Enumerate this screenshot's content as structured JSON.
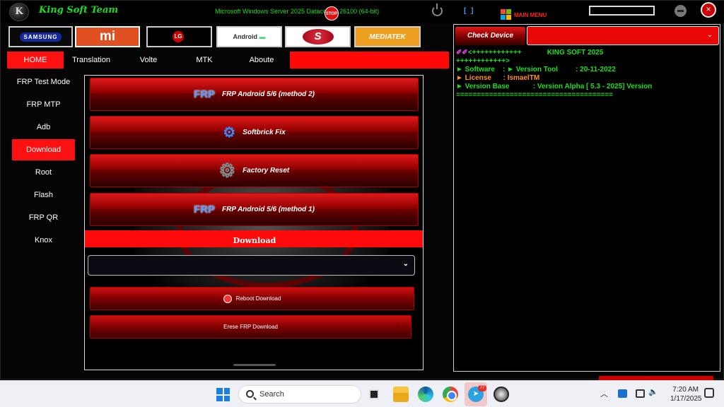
{
  "titlebar": {
    "logo_text": "K",
    "app_title": "King Soft Team",
    "os_info": "Microsoft Windows Server 2025 Datacenter 26100 (64-bit)",
    "stop_label": "STOP",
    "brackets": "[ ]",
    "main_menu": "MAIN MENU",
    "close_label": "×"
  },
  "brands": {
    "samsung": "SAMSUNG",
    "mi": "mi",
    "lg": "LG",
    "android": "Android",
    "snapdragon": "S",
    "mediatek": "MEDIATEK"
  },
  "nav": {
    "home": "HOME",
    "translation": "Translation",
    "volte": "Volte",
    "mtk": "MTK",
    "aboute": "Aboute"
  },
  "sidebar": {
    "items": [
      {
        "label": "FRP Test Mode"
      },
      {
        "label": "FRP MTP"
      },
      {
        "label": "Adb"
      },
      {
        "label": "Download"
      },
      {
        "label": "Root"
      },
      {
        "label": "Flash"
      },
      {
        "label": "FRP QR"
      },
      {
        "label": "Knox"
      }
    ],
    "active": "Download"
  },
  "center": {
    "buttons": [
      {
        "label": "FRP Android 5/6 (method 2)",
        "icon": "frp-icon"
      },
      {
        "label": "Softbrick Fix",
        "icon": "gear-icon"
      },
      {
        "label": "Factory Reset",
        "icon": "gear-icon"
      },
      {
        "label": "FRP Android 5/6 (method 1)",
        "icon": "frp-icon"
      }
    ],
    "frp_icon_text": "FRP",
    "download_header": "Download",
    "select_value": "",
    "reboot_download": "Reboot Download",
    "erase_frp_download": "Erese FRP Download"
  },
  "right": {
    "check_device": "Check Device",
    "check_select_value": "",
    "log": {
      "l1_marker": "✐✐",
      "l1_text": "<++++++++++++             KING SOFT 2025",
      "l2": "++++++++++++>",
      "l3": "► Software    : ► Version Tool         : 20-11-2022",
      "l4": "► License      : IsmaelTM",
      "l5": "► Version Base            : Version Alpha [ 5.3 - 2025] Version",
      "l6": "======================================"
    }
  },
  "taskbar": {
    "search_placeholder": "Search",
    "telegram_badge": "77",
    "time": "7:20 AM",
    "date": "1/17/2025"
  },
  "colors": {
    "accent_red": "#ff1010",
    "log_green": "#18e01e",
    "log_orange": "#ff9020"
  }
}
